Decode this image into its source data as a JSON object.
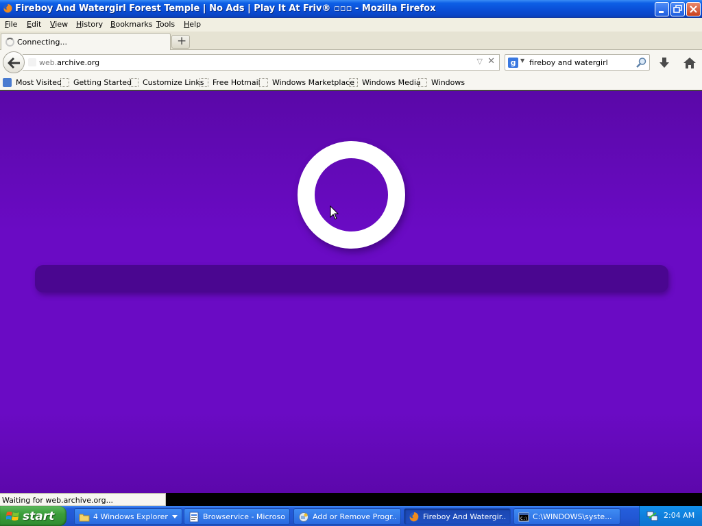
{
  "window": {
    "title": "Fireboy And Watergirl Forest Temple | No Ads | Play It At Friv® ▫▫▫ - Mozilla Firefox"
  },
  "menu": {
    "file": "File",
    "edit": "Edit",
    "view": "View",
    "history": "History",
    "bookmarks": "Bookmarks",
    "tools": "Tools",
    "help": "Help"
  },
  "tab": {
    "label": "Connecting...",
    "new_tab": "+"
  },
  "nav": {
    "url_prefix": "web.",
    "url_domain": "archive.org",
    "search_engine": "g",
    "search_query": "fireboy and watergirl"
  },
  "bookmarks": [
    {
      "label": "Most Visited"
    },
    {
      "label": "Getting Started"
    },
    {
      "label": "Customize Links"
    },
    {
      "label": "Free Hotmail"
    },
    {
      "label": "Windows Marketplace"
    },
    {
      "label": "Windows Media"
    },
    {
      "label": "Windows"
    }
  ],
  "content": {
    "loading_progress_percent": 0,
    "background_color": "#6a0bc4",
    "progress_track_color": "#4a0690"
  },
  "status": {
    "text": "Waiting for web.archive.org..."
  },
  "taskbar": {
    "start_label": "start",
    "items": [
      {
        "label": "4 Windows Explorer",
        "icon": "folder-icon"
      },
      {
        "label": "Browservice - Microso...",
        "icon": "document-icon"
      },
      {
        "label": "Add or Remove Progr...",
        "icon": "add-remove-icon"
      },
      {
        "label": "Fireboy And Watergir...",
        "icon": "firefox-icon"
      },
      {
        "label": "C:\\WINDOWS\\syste...",
        "icon": "command-prompt-icon"
      }
    ],
    "clock": "2:04 AM"
  }
}
